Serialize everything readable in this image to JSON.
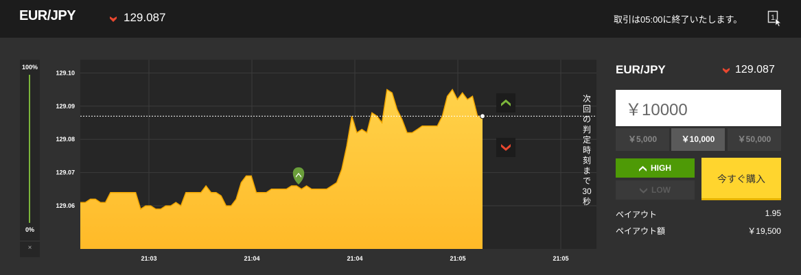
{
  "header": {
    "pair": "EUR/JPY",
    "price": "129.087",
    "expiry_notice": "取引は05:00に終了いたします。",
    "expand_label": "1"
  },
  "gauge": {
    "top_label": "100%",
    "bottom_label": "0%",
    "close_label": "×"
  },
  "chart_data": {
    "type": "area",
    "y_ticks": [
      "129.10",
      "129.09",
      "129.08",
      "129.07",
      "129.06"
    ],
    "x_ticks": [
      "21:03",
      "21:04",
      "21:04",
      "21:05",
      "21:05"
    ],
    "ylim": [
      129.047,
      129.104
    ],
    "current_rate": 129.087,
    "grid": true,
    "series": [
      {
        "values": [
          129.061,
          129.061,
          129.062,
          129.062,
          129.061,
          129.061,
          129.064,
          129.064,
          129.064,
          129.064,
          129.064,
          129.064,
          129.059,
          129.06,
          129.06,
          129.059,
          129.059,
          129.06,
          129.06,
          129.061,
          129.06,
          129.064,
          129.064,
          129.064,
          129.064,
          129.066,
          129.064,
          129.064,
          129.063,
          129.06,
          129.06,
          129.062,
          129.067,
          129.069,
          129.069,
          129.064,
          129.064,
          129.064,
          129.065,
          129.065,
          129.065,
          129.065,
          129.066,
          129.066,
          129.065,
          129.066,
          129.065,
          129.065,
          129.065,
          129.065,
          129.066,
          129.067,
          129.071,
          129.078,
          129.087,
          129.082,
          129.083,
          129.082,
          129.088,
          129.087,
          129.085,
          129.095,
          129.094,
          129.089,
          129.086,
          129.082,
          129.082,
          129.083,
          129.084,
          129.084,
          129.084,
          129.084,
          129.087,
          129.093,
          129.095,
          129.092,
          129.094,
          129.092,
          129.093,
          129.087,
          129.087
        ]
      }
    ],
    "markers": [
      {
        "type": "high-entry",
        "rate": 129.066
      }
    ],
    "countdown_label": "次回の判定時刻まで30秒"
  },
  "panel": {
    "pair": "EUR/JPY",
    "price": "129.087",
    "amount": "￥10000",
    "presets": [
      "￥5,000",
      "￥10,000",
      "￥50,000"
    ],
    "active_preset": 1,
    "high_label": "HIGH",
    "low_label": "LOW",
    "buy_label": "今すぐ購入",
    "payout_label": "ペイアウト",
    "payout_value": "1.95",
    "payout_amount_label": "ペイアウト額",
    "payout_amount_value": "￥19,500"
  },
  "colors": {
    "down": "#e8472f",
    "up": "#7cb63b",
    "area_top": "#ffd24a",
    "area_bottom": "#ffb21e",
    "high_button": "#4e9a06",
    "buy_button": "#ffd52e"
  },
  "icons": {
    "header_trend": "down-arrow-icon",
    "expand": "expand-window-icon",
    "side_up": "up-arrow-icon",
    "side_down": "down-arrow-icon",
    "entry_marker": "map-pin-up-icon"
  }
}
